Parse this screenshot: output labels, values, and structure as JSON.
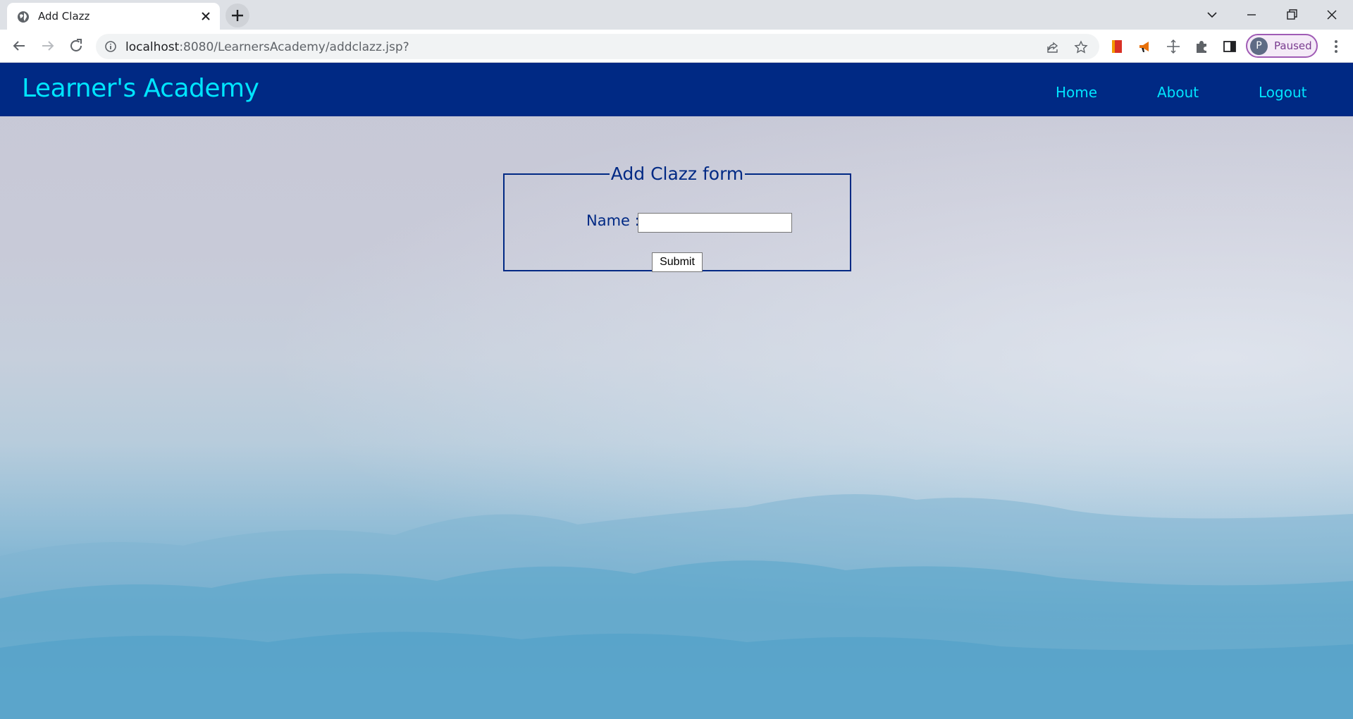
{
  "browser": {
    "tab_title": "Add Clazz",
    "url_host": "localhost",
    "url_rest": ":8080/LearnersAcademy/addclazz.jsp?",
    "profile_initial": "P",
    "profile_status": "Paused"
  },
  "header": {
    "brand": "Learner's Academy",
    "nav": [
      {
        "label": "Home"
      },
      {
        "label": "About"
      },
      {
        "label": "Logout"
      }
    ]
  },
  "form": {
    "legend": "Add Clazz form",
    "name_label": "Name :",
    "name_value": "",
    "submit_label": "Submit"
  },
  "colors": {
    "navbar_bg": "#002984",
    "brand_text": "#00e5ff",
    "form_border": "#002984"
  }
}
